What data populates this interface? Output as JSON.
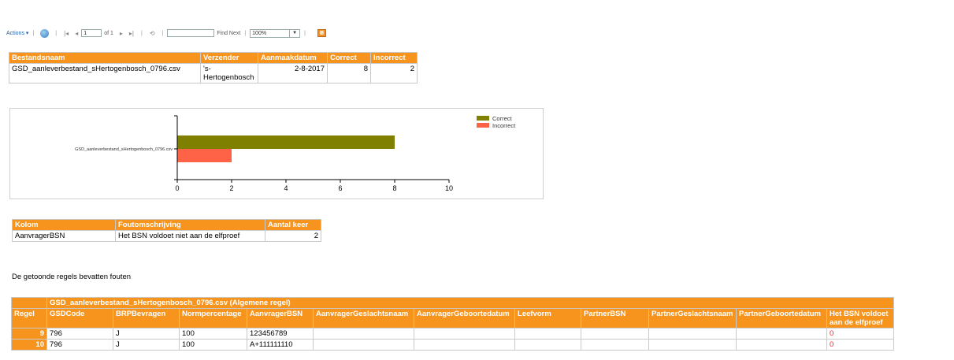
{
  "toolbar": {
    "actions_label": "Actions",
    "page_value": "1",
    "page_of": "of 1",
    "find_next_label": "Find Next",
    "zoom_value": "100%"
  },
  "summary_table": {
    "headers": [
      "Bestandsnaam",
      "Verzender",
      "Aanmaakdatum",
      "Correct",
      "Incorrect"
    ],
    "row": {
      "bestandsnaam": "GSD_aanleverbestand_sHertogenbosch_0796.csv",
      "verzender_line1": "'s-",
      "verzender_line2": "Hertogenbosch",
      "aanmaakdatum": "2-8-2017",
      "correct": "8",
      "incorrect": "2"
    }
  },
  "chart_data": {
    "type": "bar",
    "orientation": "horizontal",
    "categories": [
      "GSD_aanleverbestand_sHertogenbosch_0796.csv"
    ],
    "series": [
      {
        "name": "Correct",
        "values": [
          8
        ],
        "color": "#808000"
      },
      {
        "name": "Incorrect",
        "values": [
          2
        ],
        "color": "#ff6347"
      }
    ],
    "xlim": [
      0,
      10
    ],
    "xticks": [
      "0",
      "2",
      "4",
      "6",
      "8",
      "10"
    ],
    "legend": "top-right"
  },
  "error_table": {
    "headers": [
      "Kolom",
      "Foutomschrijving",
      "Aantal keer"
    ],
    "row": {
      "kolom": "AanvragerBSN",
      "foutomschrijving": "Het BSN voldoet niet aan de elfproef",
      "aantal": "2"
    }
  },
  "caption": "De getoonde regels bevatten fouten",
  "detail_table": {
    "group_title": "GSD_aanleverbestand_sHertogenbosch_0796.csv (Algemene regel)",
    "headers": [
      "Regel",
      "GSDCode",
      "BRPBevragen",
      "Normpercentage",
      "AanvragerBSN",
      "AanvragerGeslachtsnaam",
      "AanvragerGeboortedatum",
      "Leefvorm",
      "PartnerBSN",
      "PartnerGeslachtsnaam",
      "PartnerGeboortedatum",
      "Het BSN voldoet aan de elfproef"
    ],
    "rows": [
      {
        "regel": "9",
        "gsdcode": "796",
        "brp": "J",
        "norm": "100",
        "bsn": "123456789",
        "flag": "0"
      },
      {
        "regel": "10",
        "gsdcode": "796",
        "brp": "J",
        "norm": "100",
        "bsn": "A+111111110",
        "flag": "0"
      }
    ]
  }
}
